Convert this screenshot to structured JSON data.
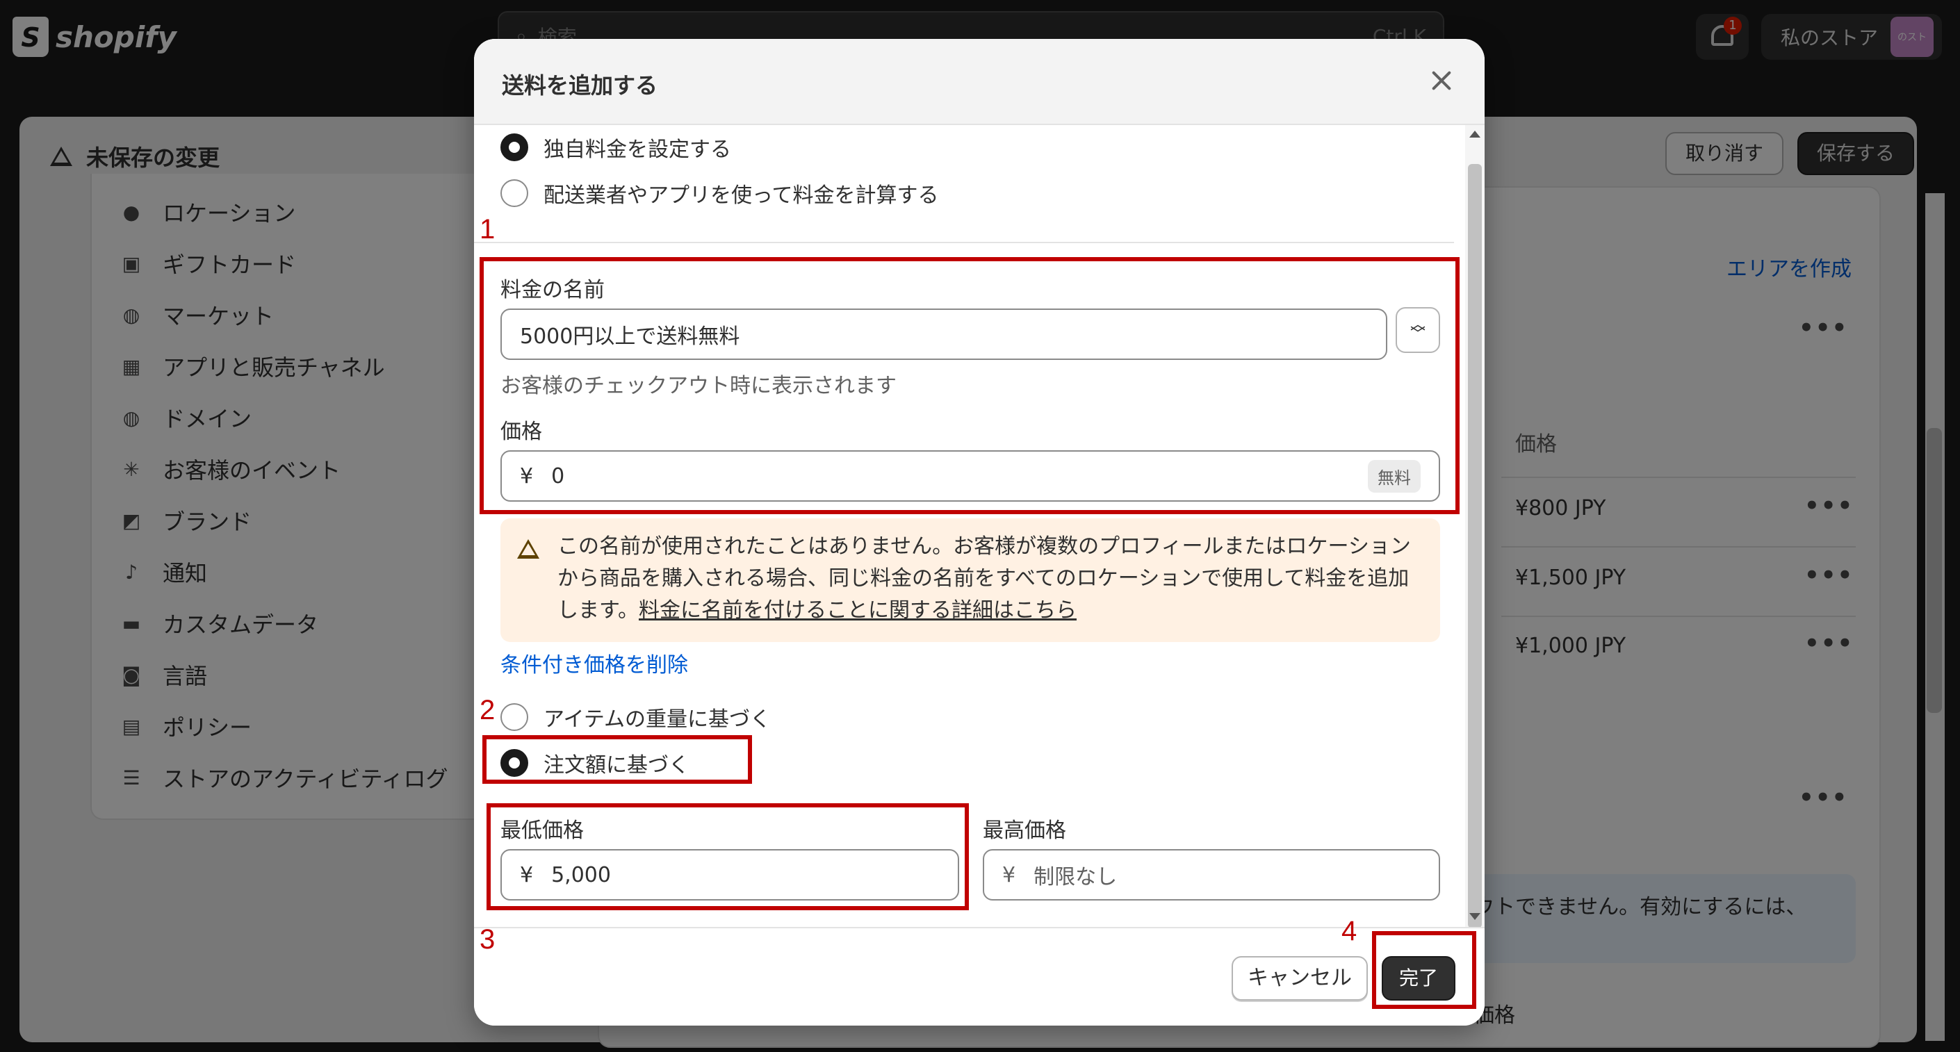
{
  "topbar": {
    "brand": "shopify",
    "search_placeholder": "検索",
    "search_shortcut": "Ctrl K",
    "notification_count": "1",
    "store_name": "私のストア",
    "store_avatar_text": "のスト"
  },
  "savebar": {
    "title": "未保存の変更",
    "discard_label": "取り消す",
    "save_label": "保存する"
  },
  "sidebar": {
    "items": [
      {
        "label": "ロケーション",
        "icon": "location-pin-icon"
      },
      {
        "label": "ギフトカード",
        "icon": "gift-card-icon"
      },
      {
        "label": "マーケット",
        "icon": "globe-icon"
      },
      {
        "label": "アプリと販売チャネル",
        "icon": "apps-icon"
      },
      {
        "label": "ドメイン",
        "icon": "globe-icon"
      },
      {
        "label": "お客様のイベント",
        "icon": "cursor-click-icon"
      },
      {
        "label": "ブランド",
        "icon": "brand-icon"
      },
      {
        "label": "通知",
        "icon": "bell-icon"
      },
      {
        "label": "カスタムデータ",
        "icon": "database-icon"
      },
      {
        "label": "言語",
        "icon": "language-icon"
      },
      {
        "label": "ポリシー",
        "icon": "policy-icon"
      },
      {
        "label": "ストアのアクティビティログ",
        "icon": "list-icon"
      }
    ]
  },
  "background": {
    "create_area_link": "エリアを作成",
    "price_column_header": "価格",
    "prices": [
      "¥800 JPY",
      "¥1,500 JPY",
      "¥1,000 JPY"
    ],
    "banner_text": "ウトできません。有効にするには、",
    "bottom_label": "価格"
  },
  "modal": {
    "title": "送料を追加する",
    "rate_type_options": [
      {
        "label": "独自料金を設定する",
        "selected": true
      },
      {
        "label": "配送業者やアプリを使って料金を計算する",
        "selected": false
      }
    ],
    "rate_name_label": "料金の名前",
    "rate_name_value": "5000円以上で送料無料",
    "rate_name_help": "お客様のチェックアウト時に表示されます",
    "price_label": "価格",
    "currency_symbol": "¥",
    "price_value": "0",
    "free_badge": "無料",
    "warning_text": "この名前が使用されたことはありません。お客様が複数のプロフィールまたはロケーションから商品を購入される場合、同じ料金の名前をすべてのロケーションで使用して料金を追加します。",
    "warning_link": "料金に名前を付けることに関する詳細はこちら",
    "remove_condition_link": "条件付き価格を削除",
    "condition_options": [
      {
        "label": "アイテムの重量に基づく",
        "selected": false
      },
      {
        "label": "注文額に基づく",
        "selected": true
      }
    ],
    "min_price_label": "最低価格",
    "min_price_value": "5,000",
    "max_price_label": "最高価格",
    "max_price_placeholder": "制限なし",
    "cancel_label": "キャンセル",
    "done_label": "完了"
  },
  "annotations": [
    "1",
    "2",
    "3",
    "4"
  ],
  "colors": {
    "annotation_red": "#c00000",
    "link_blue": "#005bd3",
    "warning_bg": "#fff1e3",
    "primary_button": "#303030"
  }
}
